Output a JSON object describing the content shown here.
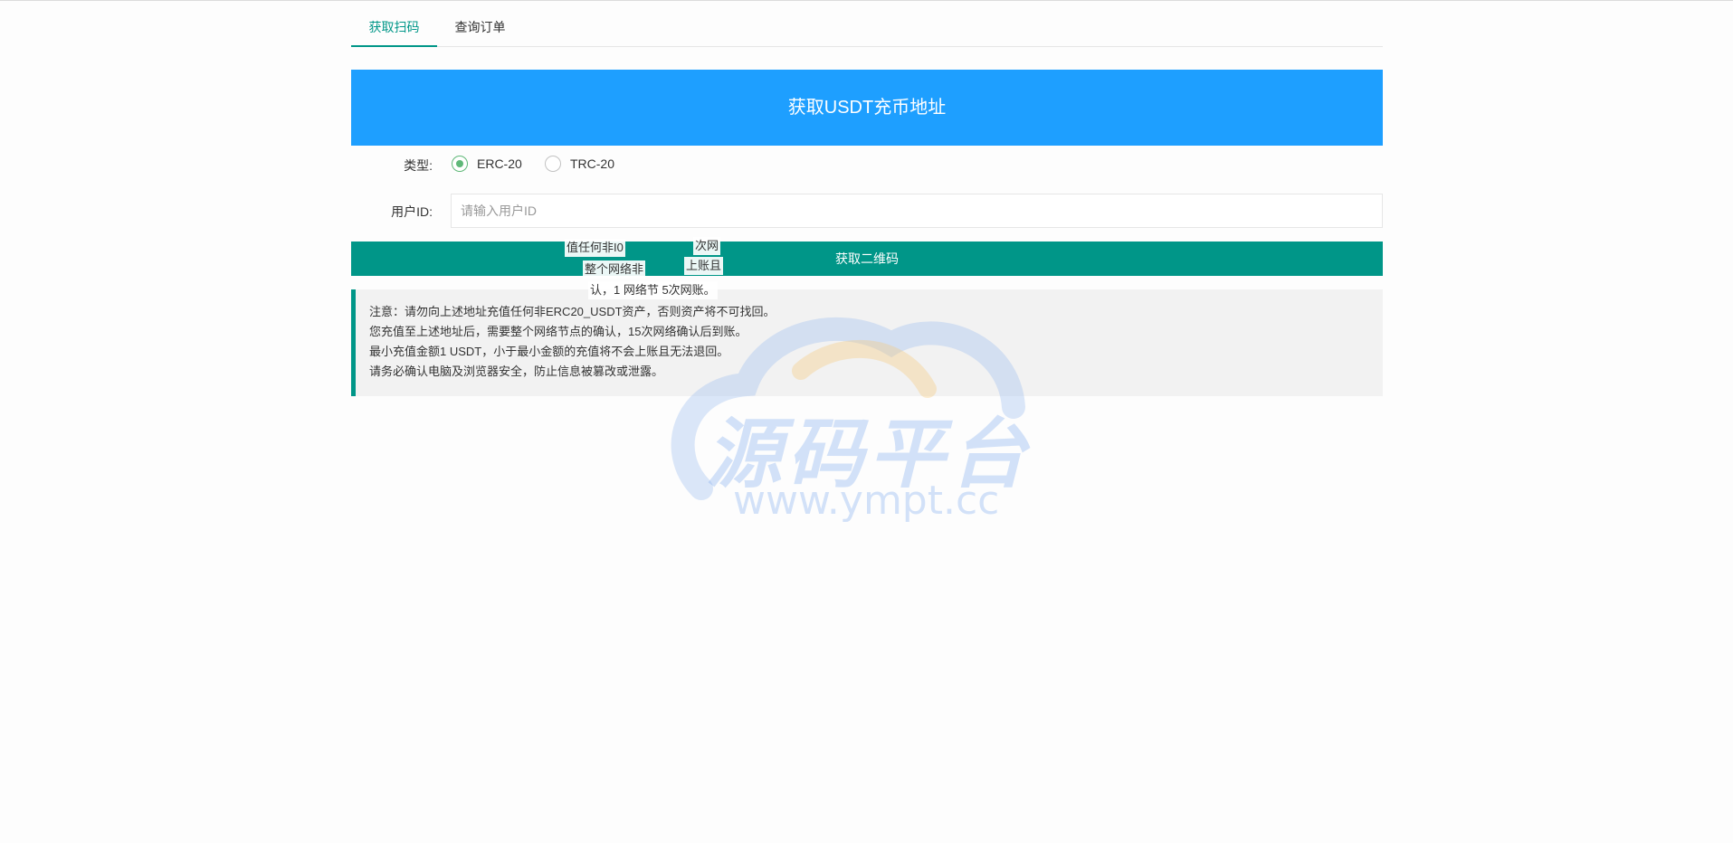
{
  "tabs": [
    {
      "label": "获取扫码"
    },
    {
      "label": "查询订单"
    }
  ],
  "banner": {
    "title": "获取USDT充币地址"
  },
  "form": {
    "type_label": "类型:",
    "type_options": [
      {
        "label": "ERC-20",
        "checked": true
      },
      {
        "label": "TRC-20",
        "checked": false
      }
    ],
    "userid_label": "用户ID:",
    "userid_placeholder": "请输入用户ID",
    "userid_value": ""
  },
  "submit": {
    "label": "获取二维码"
  },
  "notice": {
    "lines": [
      "注意：请勿向上述地址充值任何非ERC20_USDT资产，否则资产将不可找回。",
      "您充值至上述地址后，需要整个网络节点的确认，15次网络确认后到账。",
      "最小充值金额1 USDT，小于最小金额的充值将不会上账且无法退回。",
      "请务必确认电脑及浏览器安全，防止信息被篡改或泄露。"
    ]
  },
  "watermark": {
    "text": "源码平台",
    "url": "www.ympt.cc"
  },
  "ghost_text": [
    "值任何非I0",
    "次网",
    "整个网络非",
    "上账且",
    "认，1 网络节 5次网账。"
  ],
  "colors": {
    "accent": "#009688",
    "banner": "#1e9fff",
    "radio_checked": "#5fb878",
    "notice_bg": "#f2f2f2"
  }
}
